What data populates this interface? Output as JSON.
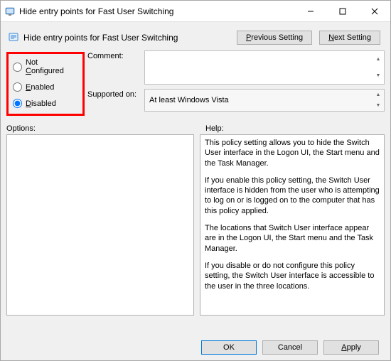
{
  "window": {
    "title": "Hide entry points for Fast User Switching"
  },
  "header": {
    "policy_title": "Hide entry points for Fast User Switching"
  },
  "nav": {
    "prev_plain": "revious Setting",
    "next_pre": "N",
    "next_plain": "ext Setting"
  },
  "state": {
    "not_configured_pre": "Not ",
    "not_configured_acc": "C",
    "not_configured_post": "onfigured",
    "enabled_acc": "E",
    "enabled_post": "nabled",
    "disabled_acc": "D",
    "disabled_post": "isabled"
  },
  "fields": {
    "comment": "Comment:",
    "supported": "Supported on:",
    "supported_value": "At least Windows Vista"
  },
  "sections": {
    "options": "Options:",
    "help": "Help:"
  },
  "help": {
    "p1": "This policy setting allows you to hide the Switch User interface in the Logon UI, the Start menu and the Task Manager.",
    "p2": "If you enable this policy setting, the Switch User interface is hidden from the user who is attempting to log on or is logged on to the computer that has this policy applied.",
    "p3": "The locations that Switch User interface appear are in the Logon UI, the Start menu and the Task Manager.",
    "p4": "If you disable or do not configure this policy setting, the Switch User interface is accessible to the user in the three locations."
  },
  "buttons": {
    "ok": "OK",
    "cancel": "Cancel",
    "apply_acc": "A",
    "apply_post": "pply"
  }
}
